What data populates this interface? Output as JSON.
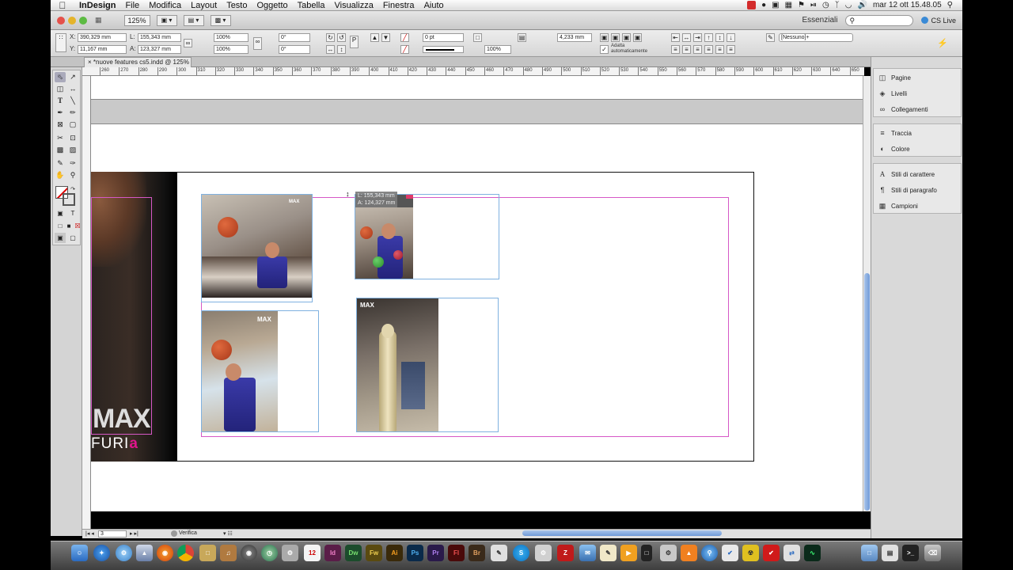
{
  "menubar": {
    "app_name": "InDesign",
    "items": [
      "File",
      "Modifica",
      "Layout",
      "Testo",
      "Oggetto",
      "Tabella",
      "Visualizza",
      "Finestra",
      "Aiuto"
    ],
    "clock": "mar 12 ott  15.48.05"
  },
  "appbar": {
    "zoom": "125%",
    "workspace": "Essenziali",
    "cs_live": "CS Live"
  },
  "control": {
    "x": "390,329 mm",
    "y": "11,167 mm",
    "w": "155,343 mm",
    "h": "123,327 mm",
    "scale_x": "100%",
    "scale_y": "100%",
    "rotation": "0°",
    "shear": "0°",
    "stroke_weight": "0 pt",
    "opacity": "100%",
    "offset": "4,233 mm",
    "autofit_label": "Adatta automaticamente",
    "style_select": "[Nessuno]+"
  },
  "document": {
    "tab_title": "*nuove features cs5.indd @ 125%"
  },
  "ruler_ticks": [
    "260",
    "270",
    "280",
    "290",
    "300",
    "310",
    "320",
    "330",
    "340",
    "350",
    "360",
    "370",
    "380",
    "390",
    "400",
    "410",
    "420",
    "430",
    "440",
    "450",
    "460",
    "470",
    "480",
    "490",
    "500",
    "510",
    "520",
    "530",
    "540",
    "550",
    "560",
    "570",
    "580",
    "590",
    "600",
    "610",
    "620",
    "630",
    "640",
    "650"
  ],
  "tooltip": {
    "line1": "L: 155,343 mm",
    "line2": "A: 124,327 mm"
  },
  "brand": {
    "word1": "MAX",
    "word2_plain": "FURI",
    "word2_accent": "a",
    "small_logo": "MAX",
    "accent_color": "#e0148c"
  },
  "statusbar": {
    "page": "3",
    "preflight": "Verifica"
  },
  "panels": {
    "group1": [
      "Pagine",
      "Livelli",
      "Collegamenti"
    ],
    "group2": [
      "Traccia",
      "Colore"
    ],
    "group3": [
      "Stili di carattere",
      "Stili di paragrafo",
      "Campioni"
    ]
  },
  "dock": [
    "Id",
    "Dw",
    "Fw",
    "Ai",
    "Ps",
    "Pr",
    "Fl",
    "Br"
  ]
}
